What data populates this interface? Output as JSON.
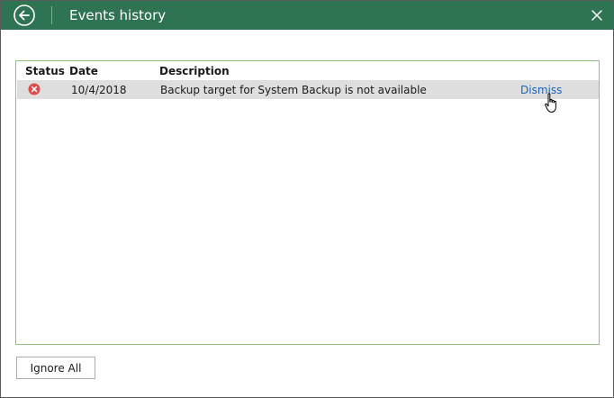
{
  "window": {
    "title": "Events history",
    "accent_color": "#2e7452",
    "back_icon": "back-arrow-circle-icon",
    "close_icon": "close-x-icon"
  },
  "table": {
    "columns": {
      "status": "Status",
      "date": "Date",
      "description": "Description"
    },
    "rows": [
      {
        "status_icon": "error-circle-icon",
        "status_color": "#e04b4b",
        "date": "10/4/2018",
        "description": "Backup target for System Backup is not available",
        "action": "Dismiss"
      }
    ]
  },
  "footer": {
    "ignore_all_label": "Ignore All"
  }
}
